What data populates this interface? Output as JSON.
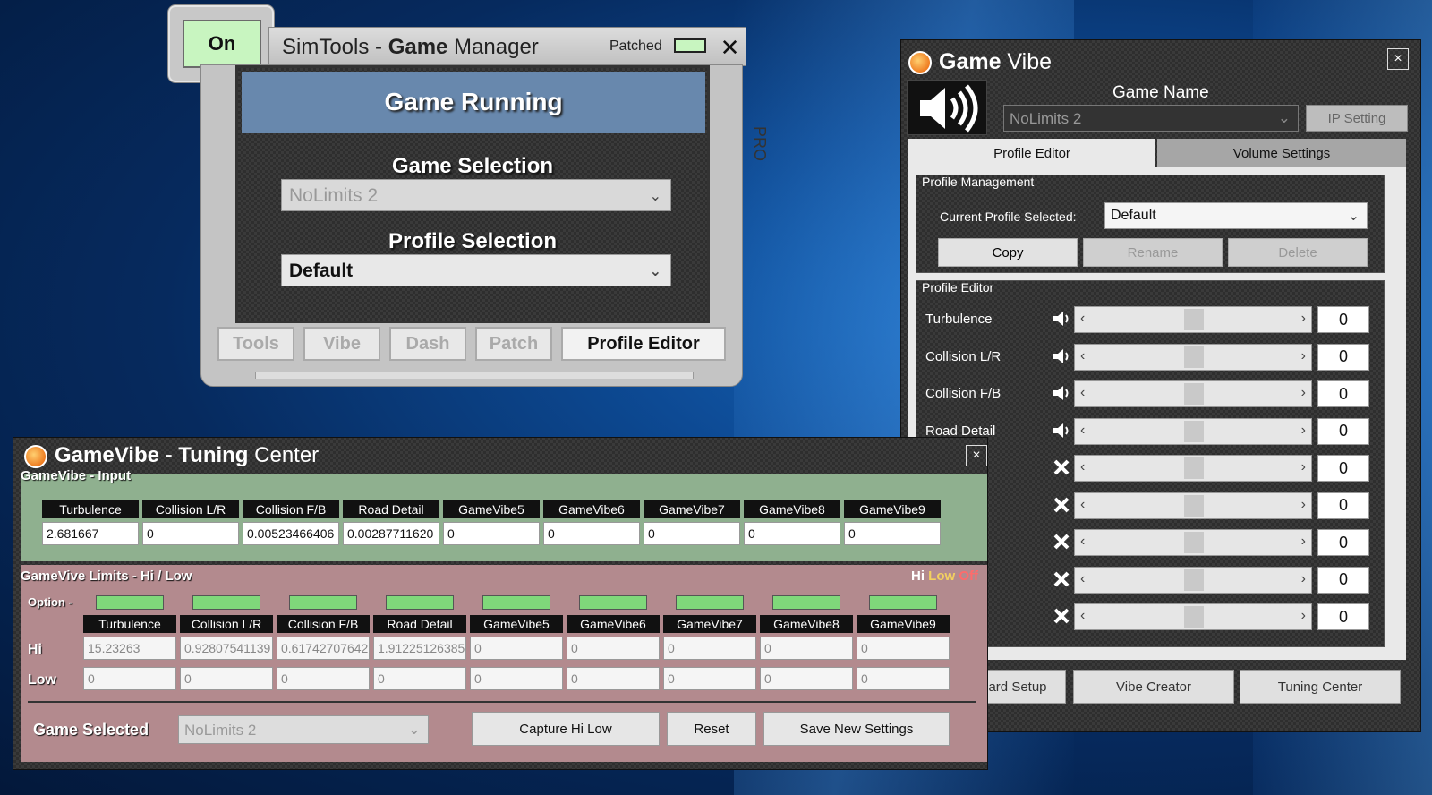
{
  "game_manager": {
    "on_label": "On",
    "title_prefix": "SimTools - ",
    "title_bold": "Game",
    "title_suffix": " Manager",
    "patched_label": "Patched",
    "close": "✕",
    "pro_label": "PRO",
    "status": "Game Running",
    "game_selection_label": "Game Selection",
    "game_selection_value": "NoLimits 2",
    "profile_selection_label": "Profile Selection",
    "profile_selection_value": "Default",
    "buttons": [
      "Tools",
      "Vibe",
      "Dash",
      "Patch",
      "Profile Editor"
    ]
  },
  "game_vibe": {
    "title_bold": "Game",
    "title_rest": " Vibe",
    "close": "×",
    "game_name_label": "Game Name",
    "game_name_value": "NoLimits 2",
    "ip_setting": "IP Setting",
    "tabs": [
      "Profile Editor",
      "Volume Settings"
    ],
    "profile_management": "Profile Management",
    "current_profile_label": "Current Profile Selected:",
    "current_profile_value": "Default",
    "pm_buttons": [
      "Copy",
      "Rename",
      "Delete"
    ],
    "profile_editor": "Profile Editor",
    "rows": [
      {
        "name": "Turbulence",
        "value": "0"
      },
      {
        "name": "Collision L/R",
        "value": "0"
      },
      {
        "name": "Collision F/B",
        "value": "0"
      },
      {
        "name": "Road Detail",
        "value": "0"
      },
      {
        "name": "",
        "value": "0"
      },
      {
        "name": "",
        "value": "0"
      },
      {
        "name": "",
        "value": "0"
      },
      {
        "name": "",
        "value": "0"
      },
      {
        "name": "",
        "value": "0"
      }
    ],
    "footer_buttons": [
      "ard Setup",
      "Vibe Creator",
      "Tuning Center"
    ]
  },
  "tuning_center": {
    "title_bold": "GameVibe - Tuning",
    "title_rest": " Center",
    "close": "×",
    "input_label": "GameVibe - Input",
    "columns": [
      "Turbulence",
      "Collision L/R",
      "Collision F/B",
      "Road Detail",
      "GameVibe5",
      "GameVibe6",
      "GameVibe7",
      "GameVibe8",
      "GameVibe9"
    ],
    "input_values": [
      "2.681667",
      "0",
      "0.00523466406",
      "0.00287711620",
      "0",
      "0",
      "0",
      "0",
      "0"
    ],
    "limits_label": "GameVive Limits - Hi / Low",
    "hi_label": "Hi",
    "low_label": "Low",
    "off_label": "Off",
    "option_label": "Option -",
    "hi_row_label": "Hi",
    "low_row_label": "Low",
    "hi_values": [
      "15.23263",
      "0.92807541139",
      "0.61742707642",
      "1.91225126385",
      "0",
      "0",
      "0",
      "0",
      "0"
    ],
    "low_values": [
      "0",
      "0",
      "0",
      "0",
      "0",
      "0",
      "0",
      "0",
      "0"
    ],
    "game_selected_label": "Game Selected",
    "game_selected_value": "NoLimits 2",
    "actions": [
      "Capture Hi Low",
      "Reset",
      "Save New Settings"
    ]
  },
  "colors": {
    "input_panel": "#8fb08f",
    "limits_panel": "#b38a8e",
    "led_green": "#c8f5c0",
    "hi_color": "#ffffff",
    "low_color": "#f2d060",
    "off_color": "#ff6b6b"
  }
}
